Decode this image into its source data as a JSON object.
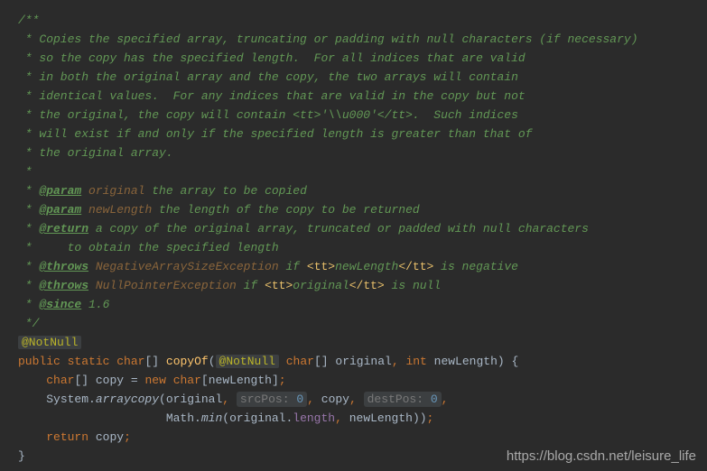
{
  "doc": {
    "lines": [
      "/**",
      " * Copies the specified array, truncating or padding with null characters (if necessary)",
      " * so the copy has the specified length.  For all indices that are valid",
      " * in both the original array and the copy, the two arrays will contain",
      " * identical values.  For any indices that are valid in the copy but not",
      " * the original, the copy will contain <tt>'\\\\u000'</tt>.  Such indices",
      " * will exist if and only if the specified length is greater than that of",
      " * the original array.",
      " *"
    ],
    "param1_tag": "@param",
    "param1_name": "original",
    "param1_desc": " the array to be copied",
    "param2_tag": "@param",
    "param2_name": "newLength",
    "param2_desc": " the length of the copy to be returned",
    "return_tag": "@return",
    "return_desc": " a copy of the original array, truncated or padded with null characters",
    "return_cont": " *     to obtain the specified length",
    "throws1_tag": "@throws",
    "throws1_ex": "NegativeArraySizeException",
    "throws1_desc_a": " if ",
    "throws1_tt_open": "<tt>",
    "throws1_var": "newLength",
    "throws1_tt_close": "</tt>",
    "throws1_desc_b": " is negative",
    "throws2_tag": "@throws",
    "throws2_ex": "NullPointerException",
    "throws2_desc_a": " if ",
    "throws2_tt_open": "<tt>",
    "throws2_var": "original",
    "throws2_tt_close": "</tt>",
    "throws2_desc_b": " is null",
    "since_tag": "@since",
    "since_val": " 1.6",
    "end": " */"
  },
  "code": {
    "annotation_box": "@NotNull",
    "kw_public": "public",
    "kw_static": "static",
    "type_char": "char",
    "brackets": "[]",
    "method_name": "copyOf",
    "paren_open": "(",
    "anno_inline": "@NotNull",
    "type_char2": "char",
    "param1": "original",
    "comma": ",",
    "type_int": "int",
    "param2": "newLength",
    "paren_close_brace": ") {",
    "line2_type": "char",
    "line2_var": "copy",
    "line2_eq": " = ",
    "line2_new": "new",
    "line2_type2": "char",
    "line2_idx_open": "[",
    "line2_idx_var": "newLength",
    "line2_idx_close": "]",
    "line2_semi": ";",
    "line3_sys": "System.",
    "line3_method": "arraycopy",
    "line3_open": "(",
    "line3_arg1": "original",
    "line3_c1": ",",
    "line3_hint1_label": "srcPos:",
    "line3_hint1_val": "0",
    "line3_c2": ",",
    "line3_arg3": "copy",
    "line3_c3": ",",
    "line3_hint2_label": "destPos:",
    "line3_hint2_val": "0",
    "line3_c4": ",",
    "line4_math": "Math.",
    "line4_min": "min",
    "line4_open": "(",
    "line4_arg1": "original.",
    "line4_field": "length",
    "line4_c": ",",
    "line4_arg2": "newLength",
    "line4_close": "))",
    "line4_semi": ";",
    "line5_return": "return",
    "line5_var": "copy",
    "line5_semi": ";",
    "line6_brace": "}"
  },
  "watermark": "https://blog.csdn.net/leisure_life"
}
